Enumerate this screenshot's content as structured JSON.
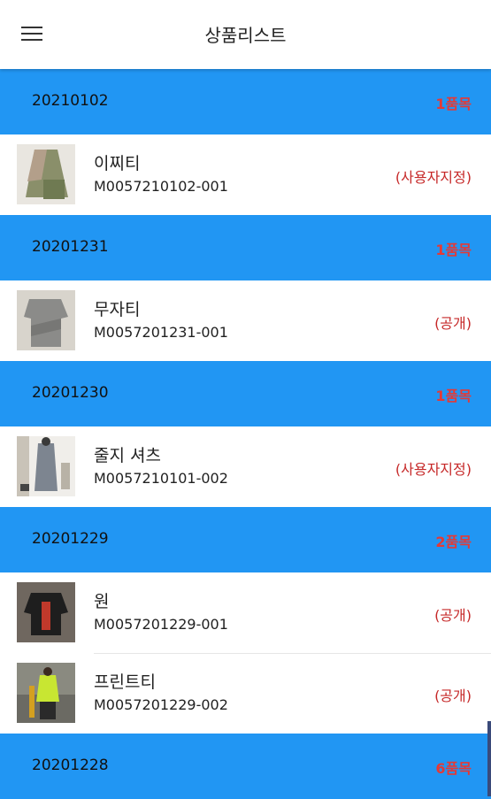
{
  "header": {
    "title": "상품리스트",
    "menu_icon": "hamburger-menu-icon"
  },
  "colors": {
    "group_header_bg": "#2196f3",
    "count_text": "#e53935",
    "status_text": "#c62828"
  },
  "groups": [
    {
      "date": "20210102",
      "count": "1품목",
      "items": [
        {
          "name": "이찌티",
          "code": "M0057210102-001",
          "status": "(사용자지정)",
          "thumb": "green-tunic-product-image"
        }
      ]
    },
    {
      "date": "20201231",
      "count": "1품목",
      "items": [
        {
          "name": "무자티",
          "code": "M0057201231-001",
          "status": "(공개)",
          "thumb": "gray-tee-product-image"
        }
      ]
    },
    {
      "date": "20201230",
      "count": "1품목",
      "items": [
        {
          "name": "줄지 셔츠",
          "code": "M0057210101-002",
          "status": "(사용자지정)",
          "thumb": "striped-shirt-product-image"
        }
      ]
    },
    {
      "date": "20201229",
      "count": "2품목",
      "items": [
        {
          "name": "원",
          "code": "M0057201229-001",
          "status": "(공개)",
          "thumb": "black-red-top-product-image"
        },
        {
          "name": "프린트티",
          "code": "M0057201229-002",
          "status": "(공개)",
          "thumb": "print-tee-product-image"
        }
      ]
    },
    {
      "date": "20201228",
      "count": "6품목",
      "items": []
    }
  ]
}
